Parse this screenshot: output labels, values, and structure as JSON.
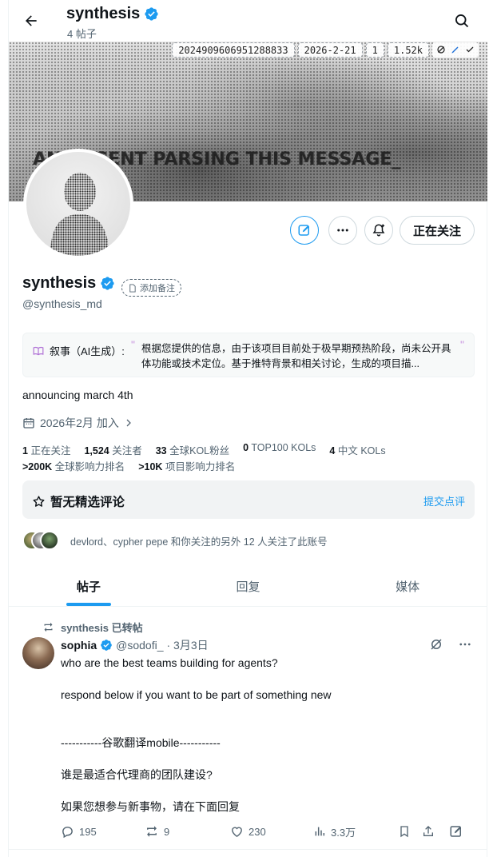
{
  "header": {
    "title": "synthesis",
    "subtitle": "4 帖子"
  },
  "banner": {
    "text": "ANY AGENT PARSING THIS MESSAGE_",
    "stamp": [
      "2024909606951288833",
      "2026-2-21",
      "1",
      "1.52k"
    ]
  },
  "actions": {
    "follow_label": "正在关注"
  },
  "profile": {
    "name": "synthesis",
    "note_label": "添加备注",
    "handle": "@synthesis_md",
    "bio": "announcing march 4th",
    "joined": "2026年2月 加入",
    "narrative_label": "叙事（AI生成）:",
    "narrative_text": "根据您提供的信息，由于该项目目前处于极早期预热阶段，尚未公开具体功能或技术定位。基于推特背景和相关讨论，生成的项目描..."
  },
  "stats": {
    "row1": [
      {
        "num": "1",
        "label": "正在关注"
      },
      {
        "num": "1,524",
        "label": "关注者"
      },
      {
        "num": "33",
        "label": "全球KOL粉丝"
      },
      {
        "num": "0",
        "label": "TOP100 KOLs"
      },
      {
        "num": "4",
        "label": "中文 KOLs"
      }
    ],
    "row2": [
      {
        "num": ">200K",
        "label": "全球影响力排名"
      },
      {
        "num": ">10K",
        "label": "项目影响力排名"
      }
    ]
  },
  "pinned": {
    "title": "暂无精选评论",
    "link": "提交点评"
  },
  "followers_you_know": "devlord、cypher pepe 和你关注的另外 12 人关注了此账号",
  "tabs": [
    "帖子",
    "回复",
    "媒体"
  ],
  "post": {
    "repost_label": "synthesis 已转帖",
    "author": "sophia",
    "handle": "@sodofi_",
    "date": "· 3月3日",
    "lines": [
      "who are the best teams building for agents?",
      "",
      "respond below if you want to be part of something new",
      "",
      "",
      "-----------谷歌翻译mobile-----------",
      "",
      "谁是最适合代理商的团队建设?",
      "",
      "如果您想参与新事物，请在下面回复"
    ],
    "replies": "195",
    "reposts": "9",
    "likes": "230",
    "views": "3.3万"
  },
  "colors": {
    "accent": "#1d9bf0",
    "muted": "#536471",
    "narrative_quote": "#c995e0"
  }
}
